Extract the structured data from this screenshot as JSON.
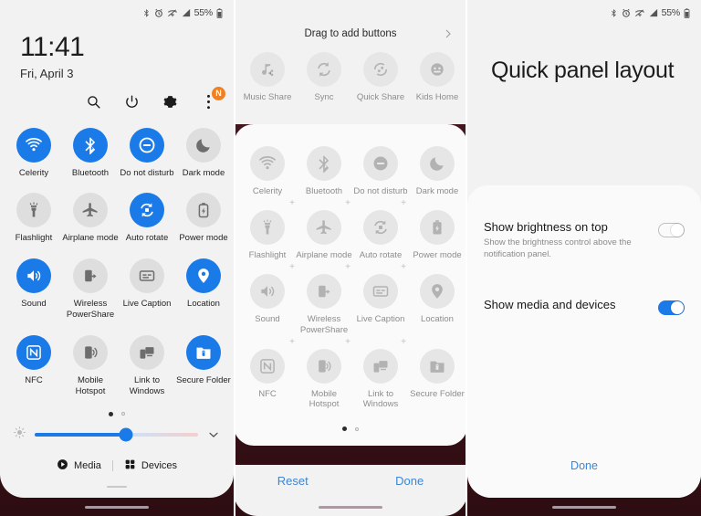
{
  "status_bar": {
    "icons": [
      "bluetooth-icon",
      "alarm-icon",
      "wifi-off-icon",
      "signal-icon"
    ],
    "battery_text": "55%"
  },
  "colors": {
    "accent_blue": "#1a7ae8",
    "link_blue": "#3b86d8",
    "badge_orange": "#f08020",
    "tile_off": "#dedede",
    "panel_bg": "#f2f2f2",
    "card_bg": "#fafafa"
  },
  "panel1": {
    "time": "11:41",
    "date": "Fri, April 3",
    "actions": [
      {
        "name": "search-icon",
        "label": "Search"
      },
      {
        "name": "power-icon",
        "label": "Power off"
      },
      {
        "name": "settings-gear-icon",
        "label": "Settings"
      },
      {
        "name": "overflow-menu-icon",
        "label": "More options",
        "badge": "N"
      }
    ],
    "tiles": [
      {
        "label": "Celerity",
        "icon": "wifi-icon",
        "active": true
      },
      {
        "label": "Bluetooth",
        "icon": "bluetooth-icon",
        "active": true
      },
      {
        "label": "Do not disturb",
        "icon": "do-not-disturb-icon",
        "active": true
      },
      {
        "label": "Dark mode",
        "icon": "moon-icon",
        "active": false
      },
      {
        "label": "Flashlight",
        "icon": "flashlight-icon",
        "active": false
      },
      {
        "label": "Airplane mode",
        "icon": "airplane-icon",
        "active": false
      },
      {
        "label": "Auto rotate",
        "icon": "auto-rotate-icon",
        "active": true
      },
      {
        "label": "Power mode",
        "icon": "power-mode-icon",
        "active": false
      },
      {
        "label": "Sound",
        "icon": "sound-icon",
        "active": true
      },
      {
        "label": "Wireless PowerShare",
        "icon": "wireless-powershare-icon",
        "active": false
      },
      {
        "label": "Live Caption",
        "icon": "live-caption-icon",
        "active": false
      },
      {
        "label": "Location",
        "icon": "location-pin-icon",
        "active": true
      },
      {
        "label": "NFC",
        "icon": "nfc-icon",
        "active": true
      },
      {
        "label": "Mobile Hotspot",
        "icon": "mobile-hotspot-icon",
        "active": false
      },
      {
        "label": "Link to Windows",
        "icon": "link-to-windows-icon",
        "active": false
      },
      {
        "label": "Secure Folder",
        "icon": "secure-folder-icon",
        "active": true
      }
    ],
    "pagination": {
      "pages": 2,
      "current": 1
    },
    "brightness": {
      "value_percent": 56,
      "icon": "brightness-icon",
      "expand_icon": "chevron-down-icon"
    },
    "footer": [
      {
        "label": "Media",
        "icon": "media-play-icon"
      },
      {
        "label": "Devices",
        "icon": "devices-grid-icon"
      }
    ]
  },
  "panel2": {
    "header_title": "Drag to add buttons",
    "header_arrow_icon": "chevron-right-icon",
    "available_tiles": [
      {
        "label": "Music Share",
        "icon": "music-share-icon"
      },
      {
        "label": "Sync",
        "icon": "sync-icon"
      },
      {
        "label": "Quick Share",
        "icon": "quick-share-icon"
      },
      {
        "label": "Kids Home",
        "icon": "kids-home-icon"
      }
    ],
    "active_tiles": [
      {
        "label": "Celerity",
        "icon": "wifi-icon"
      },
      {
        "label": "Bluetooth",
        "icon": "bluetooth-icon"
      },
      {
        "label": "Do not disturb",
        "icon": "do-not-disturb-icon"
      },
      {
        "label": "Dark mode",
        "icon": "moon-icon"
      },
      {
        "label": "Flashlight",
        "icon": "flashlight-icon"
      },
      {
        "label": "Airplane mode",
        "icon": "airplane-icon"
      },
      {
        "label": "Auto rotate",
        "icon": "auto-rotate-icon"
      },
      {
        "label": "Power mode",
        "icon": "power-mode-icon"
      },
      {
        "label": "Sound",
        "icon": "sound-icon"
      },
      {
        "label": "Wireless PowerShare",
        "icon": "wireless-powershare-icon"
      },
      {
        "label": "Live Caption",
        "icon": "live-caption-icon"
      },
      {
        "label": "Location",
        "icon": "location-pin-icon"
      },
      {
        "label": "NFC",
        "icon": "nfc-icon"
      },
      {
        "label": "Mobile Hotspot",
        "icon": "mobile-hotspot-icon"
      },
      {
        "label": "Link to Windows",
        "icon": "link-to-windows-icon"
      },
      {
        "label": "Secure Folder",
        "icon": "secure-folder-icon"
      }
    ],
    "add_marker": "+",
    "pagination": {
      "pages": 2,
      "current": 1
    },
    "reset_label": "Reset",
    "done_label": "Done"
  },
  "panel3": {
    "title": "Quick panel layout",
    "settings": [
      {
        "title": "Show brightness on top",
        "description": "Show the brightness control above the notification panel.",
        "toggle": "off"
      },
      {
        "title": "Show media and devices",
        "description": "",
        "toggle": "on"
      }
    ],
    "done_label": "Done"
  }
}
